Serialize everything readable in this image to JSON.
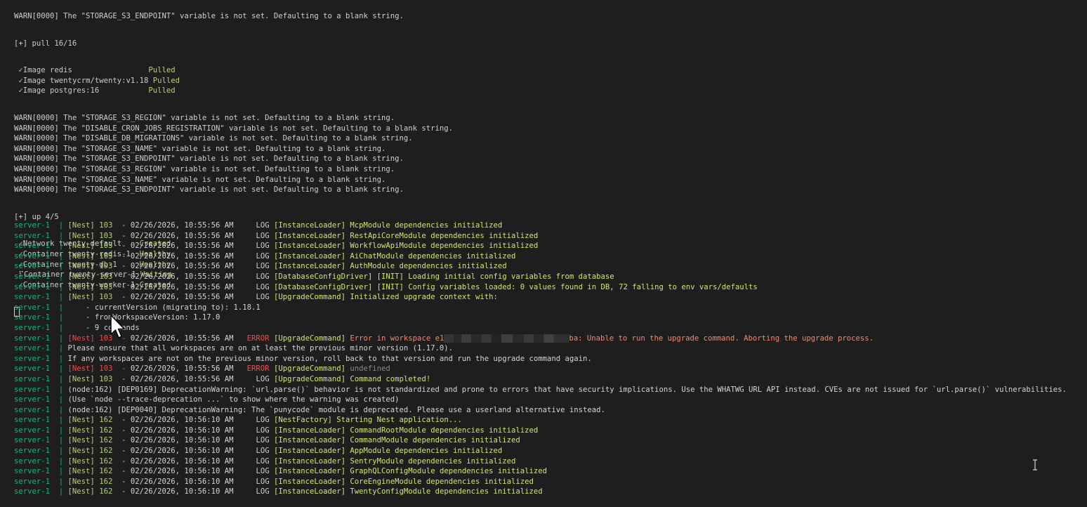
{
  "top_section": {
    "cut_line": "WARN[0000] The \"STORAGE_S3_ENDPOINT\" variable is not set. Defaulting to a blank string.",
    "pull_header": "[+] pull 16/16",
    "pulled": [
      {
        "check": "✓",
        "name": "Image redis                ",
        "status": "Pulled"
      },
      {
        "check": "✓",
        "name": "Image twentycrm/twenty:v1.18",
        "status": "Pulled"
      },
      {
        "check": "✓",
        "name": "Image postgres:16          ",
        "status": "Pulled"
      }
    ],
    "warnings": [
      "WARN[0000] The \"STORAGE_S3_REGION\" variable is not set. Defaulting to a blank string.",
      "WARN[0000] The \"DISABLE_CRON_JOBS_REGISTRATION\" variable is not set. Defaulting to a blank string.",
      "WARN[0000] The \"DISABLE_DB_MIGRATIONS\" variable is not set. Defaulting to a blank string.",
      "WARN[0000] The \"STORAGE_S3_NAME\" variable is not set. Defaulting to a blank string.",
      "WARN[0000] The \"STORAGE_S3_ENDPOINT\" variable is not set. Defaulting to a blank string.",
      "WARN[0000] The \"STORAGE_S3_REGION\" variable is not set. Defaulting to a blank string.",
      "WARN[0000] The \"STORAGE_S3_NAME\" variable is not set. Defaulting to a blank string.",
      "WARN[0000] The \"STORAGE_S3_ENDPOINT\" variable is not set. Defaulting to a blank string."
    ],
    "up_header": "[+] up 4/5",
    "containers": [
      {
        "check": "✓",
        "name": "Network twenty_default   ",
        "status": "Created"
      },
      {
        "check": "✓",
        "name": "Container twenty-redis-1 ",
        "status": "Healthy"
      },
      {
        "check": "✓",
        "name": "Container twenty-db-1    ",
        "status": "Healthy"
      },
      {
        "check": "⠏",
        "name": "Container twenty-server-1",
        "status": "Waiting"
      },
      {
        "check": "✓",
        "name": "Container twenty-worker-1",
        "status": "Created"
      }
    ]
  },
  "log_lines": [
    {
      "prefix": "server-1  | ",
      "nest": "[Nest] 103  - ",
      "time": "02/26/2026, 10:55:56 AM     ",
      "level": "LOG ",
      "ctx": "[InstanceLoader] ",
      "msg": "McpModule dependencies initialized",
      "kind": "log"
    },
    {
      "prefix": "server-1  | ",
      "nest": "[Nest] 103  - ",
      "time": "02/26/2026, 10:55:56 AM     ",
      "level": "LOG ",
      "ctx": "[InstanceLoader] ",
      "msg": "RestApiCoreModule dependencies initialized",
      "kind": "log"
    },
    {
      "prefix": "server-1  | ",
      "nest": "[Nest] 103  - ",
      "time": "02/26/2026, 10:55:56 AM     ",
      "level": "LOG ",
      "ctx": "[InstanceLoader] ",
      "msg": "WorkflowApiModule dependencies initialized",
      "kind": "log"
    },
    {
      "prefix": "server-1  | ",
      "nest": "[Nest] 103  - ",
      "time": "02/26/2026, 10:55:56 AM     ",
      "level": "LOG ",
      "ctx": "[InstanceLoader] ",
      "msg": "AiChatModule dependencies initialized",
      "kind": "log"
    },
    {
      "prefix": "server-1  | ",
      "nest": "[Nest] 103  - ",
      "time": "02/26/2026, 10:55:56 AM     ",
      "level": "LOG ",
      "ctx": "[InstanceLoader] ",
      "msg": "AuthModule dependencies initialized",
      "kind": "log"
    },
    {
      "prefix": "server-1  | ",
      "nest": "[Nest] 103  - ",
      "time": "02/26/2026, 10:55:56 AM     ",
      "level": "LOG ",
      "ctx": "[DatabaseConfigDriver] ",
      "msg": "[INIT] Loading initial config variables from database",
      "kind": "log"
    },
    {
      "prefix": "server-1  | ",
      "nest": "[Nest] 103  - ",
      "time": "02/26/2026, 10:55:56 AM     ",
      "level": "LOG ",
      "ctx": "[DatabaseConfigDriver] ",
      "msg": "[INIT] Config variables loaded: 0 values found in DB, 72 falling to env vars/defaults",
      "kind": "log"
    },
    {
      "prefix": "server-1  | ",
      "nest": "[Nest] 103  - ",
      "time": "02/26/2026, 10:55:56 AM     ",
      "level": "LOG ",
      "ctx": "[UpgradeCommand] ",
      "msg": "Initialized upgrade context with:",
      "kind": "log"
    },
    {
      "prefix": "server-1  | ",
      "plain": "    - currentVersion (migrating to): 1.18.1",
      "kind": "plain"
    },
    {
      "prefix": "server-1  | ",
      "plain": "    - fromWorkspaceVersion: 1.17.0",
      "kind": "plain"
    },
    {
      "prefix": "server-1  | ",
      "plain": "    - 9 commands",
      "kind": "plain"
    },
    {
      "prefix": "server-1  | ",
      "nest": "[Nest] 103  - ",
      "time": "02/26/2026, 10:55:56 AM   ",
      "level": "ERROR ",
      "ctx": "[UpgradeCommand] ",
      "msg": "Error in workspace e1",
      "msg_after": "ba: Unable to run the upgrade command. Aborting the upgrade process.",
      "kind": "error_redacted"
    },
    {
      "prefix": "server-1  | ",
      "plain": "Please ensure that all workspaces are on at least the previous minor version (1.17.0).",
      "kind": "plain"
    },
    {
      "prefix": "server-1  | ",
      "plain": "If any workspaces are not on the previous minor version, roll back to that version and run the upgrade command again.",
      "kind": "plain"
    },
    {
      "prefix": "server-1  | ",
      "nest": "[Nest] 103  - ",
      "time": "02/26/2026, 10:55:56 AM   ",
      "level": "ERROR ",
      "ctx": "[UpgradeCommand] ",
      "msg": "undefined",
      "kind": "error_undef"
    },
    {
      "prefix": "server-1  | ",
      "nest": "[Nest] 103  - ",
      "time": "02/26/2026, 10:55:56 AM     ",
      "level": "LOG ",
      "ctx": "[UpgradeCommand] ",
      "msg": "Command completed!",
      "kind": "log"
    },
    {
      "prefix": "server-1  | ",
      "plain": "(node:162) [DEP0169] DeprecationWarning: `url.parse()` behavior is not standardized and prone to errors that have security implications. Use the WHATWG URL API instead. CVEs are not issued for `url.parse()` vulnerabilities.",
      "kind": "plain"
    },
    {
      "prefix": "server-1  | ",
      "plain": "(Use `node --trace-deprecation ...` to show where the warning was created)",
      "kind": "plain"
    },
    {
      "prefix": "server-1  | ",
      "plain": "(node:162) [DEP0040] DeprecationWarning: The `punycode` module is deprecated. Please use a userland alternative instead.",
      "kind": "plain"
    },
    {
      "prefix": "server-1  | ",
      "nest": "[Nest] 162  - ",
      "time": "02/26/2026, 10:56:10 AM     ",
      "level": "LOG ",
      "ctx": "[NestFactory] ",
      "msg": "Starting Nest application...",
      "kind": "log"
    },
    {
      "prefix": "server-1  | ",
      "nest": "[Nest] 162  - ",
      "time": "02/26/2026, 10:56:10 AM     ",
      "level": "LOG ",
      "ctx": "[InstanceLoader] ",
      "msg": "CommandRootModule dependencies initialized",
      "kind": "log"
    },
    {
      "prefix": "server-1  | ",
      "nest": "[Nest] 162  - ",
      "time": "02/26/2026, 10:56:10 AM     ",
      "level": "LOG ",
      "ctx": "[InstanceLoader] ",
      "msg": "CommandModule dependencies initialized",
      "kind": "log"
    },
    {
      "prefix": "server-1  | ",
      "nest": "[Nest] 162  - ",
      "time": "02/26/2026, 10:56:10 AM     ",
      "level": "LOG ",
      "ctx": "[InstanceLoader] ",
      "msg": "AppModule dependencies initialized",
      "kind": "log"
    },
    {
      "prefix": "server-1  | ",
      "nest": "[Nest] 162  - ",
      "time": "02/26/2026, 10:56:10 AM     ",
      "level": "LOG ",
      "ctx": "[InstanceLoader] ",
      "msg": "SentryModule dependencies initialized",
      "kind": "log"
    },
    {
      "prefix": "server-1  | ",
      "nest": "[Nest] 162  - ",
      "time": "02/26/2026, 10:56:10 AM     ",
      "level": "LOG ",
      "ctx": "[InstanceLoader] ",
      "msg": "GraphQLConfigModule dependencies initialized",
      "kind": "log"
    },
    {
      "prefix": "server-1  | ",
      "nest": "[Nest] 162  - ",
      "time": "02/26/2026, 10:56:10 AM     ",
      "level": "LOG ",
      "ctx": "[InstanceLoader] ",
      "msg": "CoreEngineModule dependencies initialized",
      "kind": "log"
    },
    {
      "prefix": "server-1  | ",
      "nest": "[Nest] 162  - ",
      "time": "02/26/2026, 10:56:10 AM     ",
      "level": "LOG ",
      "ctx": "[InstanceLoader] ",
      "msg": "TwentyConfigModule dependencies initialized",
      "kind": "log"
    }
  ],
  "icons": {
    "mouse_pointer": "arrow-pointer-icon",
    "text_cursor": "i-beam-icon"
  }
}
